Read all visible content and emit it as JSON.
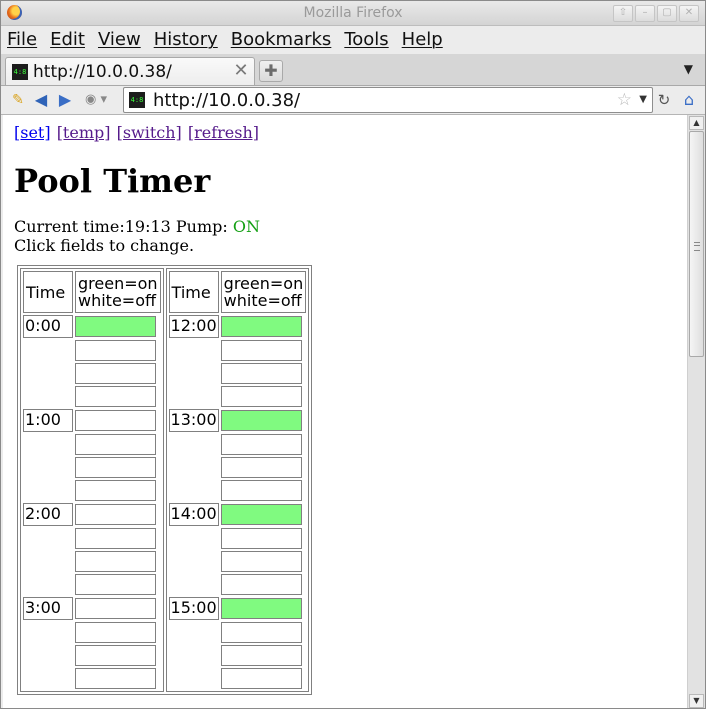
{
  "window": {
    "title": "Mozilla Firefox",
    "controls": [
      "⇧",
      "–",
      "▢",
      "✕"
    ]
  },
  "menubar": [
    "File",
    "Edit",
    "View",
    "History",
    "Bookmarks",
    "Tools",
    "Help"
  ],
  "tab": {
    "label": "http://10.0.0.38/",
    "favicon_text": "4:8"
  },
  "urlbar": {
    "value": "http://10.0.0.38/"
  },
  "links": [
    "[set]",
    "[temp]",
    "[switch]",
    "[refresh]"
  ],
  "heading": "Pool Timer",
  "status": {
    "time_label": "Current time:",
    "time_value": "19:13",
    "pump_label": " Pump: ",
    "pump_value": "ON",
    "instructions": "Click fields to change."
  },
  "colors": {
    "on": "#80fa80",
    "off": "#ffffff",
    "pump_on_text": "#14a014"
  },
  "schedule": {
    "header_time": "Time",
    "header_legend_line1": "green=on",
    "header_legend_line2": "white=off",
    "left": [
      {
        "hour": "0:00",
        "slots": [
          true,
          false,
          false,
          false
        ]
      },
      {
        "hour": "1:00",
        "slots": [
          false,
          false,
          false,
          false
        ]
      },
      {
        "hour": "2:00",
        "slots": [
          false,
          false,
          false,
          false
        ]
      },
      {
        "hour": "3:00",
        "slots": [
          false,
          false,
          false,
          false
        ]
      }
    ],
    "right": [
      {
        "hour": "12:00",
        "slots": [
          true,
          false,
          false,
          false
        ]
      },
      {
        "hour": "13:00",
        "slots": [
          true,
          false,
          false,
          false
        ]
      },
      {
        "hour": "14:00",
        "slots": [
          true,
          false,
          false,
          false
        ]
      },
      {
        "hour": "15:00",
        "slots": [
          true,
          false,
          false,
          false
        ]
      }
    ]
  }
}
